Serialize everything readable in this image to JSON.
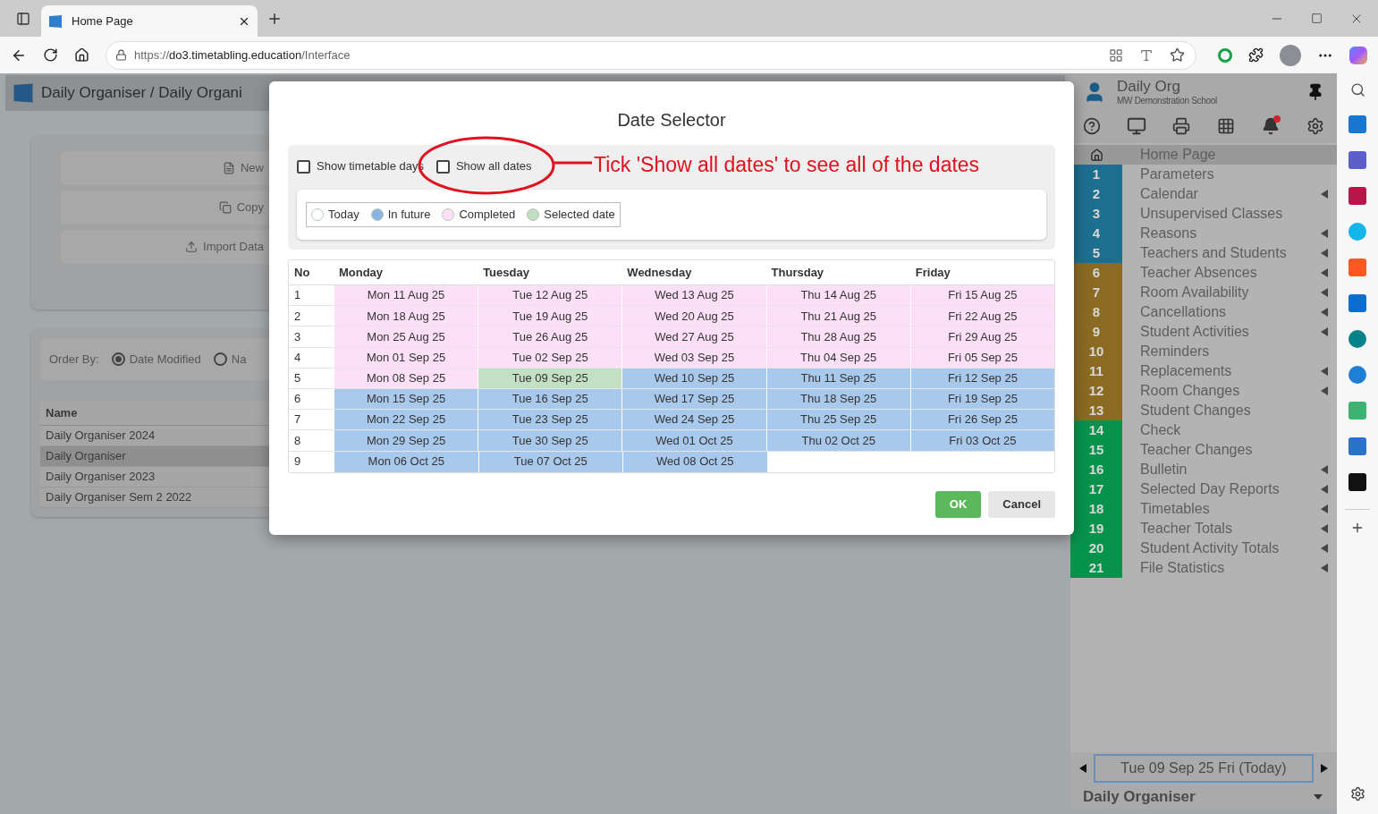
{
  "browser": {
    "tab": {
      "title": "Home Page"
    },
    "address": {
      "scheme": "https://",
      "host": "do3.timetabling.education",
      "path": "/Interface"
    }
  },
  "app": {
    "title": "Daily Organiser / Daily Organi",
    "actions": [
      {
        "kind": "new",
        "label": "New"
      },
      {
        "kind": "copy",
        "label": "Copy"
      },
      {
        "kind": "import",
        "label": "Import Data"
      }
    ],
    "order_by": {
      "label": "Order By:",
      "options": [
        {
          "label": "Date Modified",
          "selected": true
        },
        {
          "label": "Na",
          "selected": false
        }
      ]
    },
    "files": {
      "column": "Name",
      "rows": [
        {
          "name": "Daily Organiser 2024",
          "selected": false
        },
        {
          "name": "Daily Organiser",
          "selected": true
        },
        {
          "name": "Daily Organiser 2023",
          "selected": false
        },
        {
          "name": "Daily Organiser Sem 2 2022",
          "selected": false
        }
      ]
    }
  },
  "sidebar": {
    "title": "Daily Org",
    "school": "MW Demonstration School",
    "unread_notifications": true,
    "nav": [
      {
        "kind": "home",
        "label": "Home Page",
        "selected": true,
        "submenu": false
      },
      {
        "kind": "numbered",
        "number": "1",
        "label": "Parameters",
        "color": "#1d6f8f",
        "selected": false,
        "submenu": false
      },
      {
        "kind": "numbered",
        "number": "2",
        "label": "Calendar",
        "color": "#1d6f8f",
        "selected": false,
        "submenu": true
      },
      {
        "kind": "numbered",
        "number": "3",
        "label": "Unsupervised Classes",
        "color": "#1d6f8f",
        "selected": false,
        "submenu": false
      },
      {
        "kind": "numbered",
        "number": "4",
        "label": "Reasons",
        "color": "#1d6f8f",
        "selected": false,
        "submenu": true
      },
      {
        "kind": "numbered",
        "number": "5",
        "label": "Teachers and Students",
        "color": "#1d6f8f",
        "selected": false,
        "submenu": true
      },
      {
        "kind": "numbered",
        "number": "6",
        "label": "Teacher Absences",
        "color": "#8b6a22",
        "selected": false,
        "submenu": true
      },
      {
        "kind": "numbered",
        "number": "7",
        "label": "Room Availability",
        "color": "#8b6a22",
        "selected": false,
        "submenu": true
      },
      {
        "kind": "numbered",
        "number": "8",
        "label": "Cancellations",
        "color": "#8b6a22",
        "selected": false,
        "submenu": true
      },
      {
        "kind": "numbered",
        "number": "9",
        "label": "Student Activities",
        "color": "#8b6a22",
        "selected": false,
        "submenu": true
      },
      {
        "kind": "numbered",
        "number": "10",
        "label": "Reminders",
        "color": "#8b6a22",
        "selected": false,
        "submenu": false
      },
      {
        "kind": "numbered",
        "number": "11",
        "label": "Replacements",
        "color": "#8b6a22",
        "selected": false,
        "submenu": true
      },
      {
        "kind": "numbered",
        "number": "12",
        "label": "Room Changes",
        "color": "#8b6a22",
        "selected": false,
        "submenu": true
      },
      {
        "kind": "numbered",
        "number": "13",
        "label": "Student Changes",
        "color": "#8b6a22",
        "selected": false,
        "submenu": false
      },
      {
        "kind": "numbered",
        "number": "14",
        "label": "Check",
        "color": "#07924c",
        "selected": false,
        "submenu": false
      },
      {
        "kind": "numbered",
        "number": "15",
        "label": "Teacher Changes",
        "color": "#07924c",
        "selected": false,
        "submenu": false
      },
      {
        "kind": "numbered",
        "number": "16",
        "label": "Bulletin",
        "color": "#07924c",
        "selected": false,
        "submenu": true
      },
      {
        "kind": "numbered",
        "number": "17",
        "label": "Selected Day Reports",
        "color": "#07924c",
        "selected": false,
        "submenu": true
      },
      {
        "kind": "numbered",
        "number": "18",
        "label": "Timetables",
        "color": "#07924c",
        "selected": false,
        "submenu": true
      },
      {
        "kind": "numbered",
        "number": "19",
        "label": "Teacher Totals",
        "color": "#07924c",
        "selected": false,
        "submenu": true
      },
      {
        "kind": "numbered",
        "number": "20",
        "label": "Student Activity Totals",
        "color": "#07924c",
        "selected": false,
        "submenu": true
      },
      {
        "kind": "numbered",
        "number": "21",
        "label": "File Statistics",
        "color": "#07924c",
        "selected": false,
        "submenu": true
      }
    ],
    "date": "Tue 09 Sep 25 Fri (Today)",
    "organiser": "Daily Organiser"
  },
  "dialog": {
    "title": "Date Selector",
    "options": [
      {
        "label": "Show timetable days",
        "checked": false
      },
      {
        "label": "Show all dates",
        "checked": false
      }
    ],
    "annotation": "Tick 'Show all dates' to see all of the dates",
    "legend": [
      {
        "label": "Today",
        "color": "#ffffff"
      },
      {
        "label": "In future",
        "color": "#8cb2df"
      },
      {
        "label": "Completed",
        "color": "#fde0f8"
      },
      {
        "label": "Selected date",
        "color": "#c2dcc2"
      }
    ],
    "columns": [
      "No",
      "Monday",
      "Tuesday",
      "Wednesday",
      "Thursday",
      "Friday"
    ],
    "rows": [
      {
        "no": "1",
        "cells": [
          {
            "date": "Mon 11 Aug 25",
            "kind": "completed"
          },
          {
            "date": "Tue 12 Aug 25",
            "kind": "completed"
          },
          {
            "date": "Wed 13 Aug 25",
            "kind": "completed"
          },
          {
            "date": "Thu 14 Aug 25",
            "kind": "completed"
          },
          {
            "date": "Fri 15 Aug 25",
            "kind": "completed"
          }
        ]
      },
      {
        "no": "2",
        "cells": [
          {
            "date": "Mon 18 Aug 25",
            "kind": "completed"
          },
          {
            "date": "Tue 19 Aug 25",
            "kind": "completed"
          },
          {
            "date": "Wed 20 Aug 25",
            "kind": "completed"
          },
          {
            "date": "Thu 21 Aug 25",
            "kind": "completed"
          },
          {
            "date": "Fri 22 Aug 25",
            "kind": "completed"
          }
        ]
      },
      {
        "no": "3",
        "cells": [
          {
            "date": "Mon 25 Aug 25",
            "kind": "completed"
          },
          {
            "date": "Tue 26 Aug 25",
            "kind": "completed"
          },
          {
            "date": "Wed 27 Aug 25",
            "kind": "completed"
          },
          {
            "date": "Thu 28 Aug 25",
            "kind": "completed"
          },
          {
            "date": "Fri 29 Aug 25",
            "kind": "completed"
          }
        ]
      },
      {
        "no": "4",
        "cells": [
          {
            "date": "Mon 01 Sep 25",
            "kind": "completed"
          },
          {
            "date": "Tue 02 Sep 25",
            "kind": "completed"
          },
          {
            "date": "Wed 03 Sep 25",
            "kind": "completed"
          },
          {
            "date": "Thu 04 Sep 25",
            "kind": "completed"
          },
          {
            "date": "Fri 05 Sep 25",
            "kind": "completed"
          }
        ]
      },
      {
        "no": "5",
        "cells": [
          {
            "date": "Mon 08 Sep 25",
            "kind": "completed"
          },
          {
            "date": "Tue 09 Sep 25",
            "kind": "selected"
          },
          {
            "date": "Wed 10 Sep 25",
            "kind": "future"
          },
          {
            "date": "Thu 11 Sep 25",
            "kind": "future"
          },
          {
            "date": "Fri 12 Sep 25",
            "kind": "future"
          }
        ]
      },
      {
        "no": "6",
        "cells": [
          {
            "date": "Mon 15 Sep 25",
            "kind": "future"
          },
          {
            "date": "Tue 16 Sep 25",
            "kind": "future"
          },
          {
            "date": "Wed 17 Sep 25",
            "kind": "future"
          },
          {
            "date": "Thu 18 Sep 25",
            "kind": "future"
          },
          {
            "date": "Fri 19 Sep 25",
            "kind": "future"
          }
        ]
      },
      {
        "no": "7",
        "cells": [
          {
            "date": "Mon 22 Sep 25",
            "kind": "future"
          },
          {
            "date": "Tue 23 Sep 25",
            "kind": "future"
          },
          {
            "date": "Wed 24 Sep 25",
            "kind": "future"
          },
          {
            "date": "Thu 25 Sep 25",
            "kind": "future"
          },
          {
            "date": "Fri 26 Sep 25",
            "kind": "future"
          }
        ]
      },
      {
        "no": "8",
        "cells": [
          {
            "date": "Mon 29 Sep 25",
            "kind": "future"
          },
          {
            "date": "Tue 30 Sep 25",
            "kind": "future"
          },
          {
            "date": "Wed 01 Oct 25",
            "kind": "future"
          },
          {
            "date": "Thu 02 Oct 25",
            "kind": "future"
          },
          {
            "date": "Fri 03 Oct 25",
            "kind": "future"
          }
        ]
      },
      {
        "no": "9",
        "cells": [
          {
            "date": "Mon 06 Oct 25",
            "kind": "future"
          },
          {
            "date": "Tue 07 Oct 25",
            "kind": "future"
          },
          {
            "date": "Wed 08 Oct 25",
            "kind": "future"
          }
        ]
      }
    ],
    "buttons": [
      {
        "label": "OK",
        "kind": "primary"
      },
      {
        "label": "Cancel",
        "kind": "secondary"
      }
    ]
  }
}
